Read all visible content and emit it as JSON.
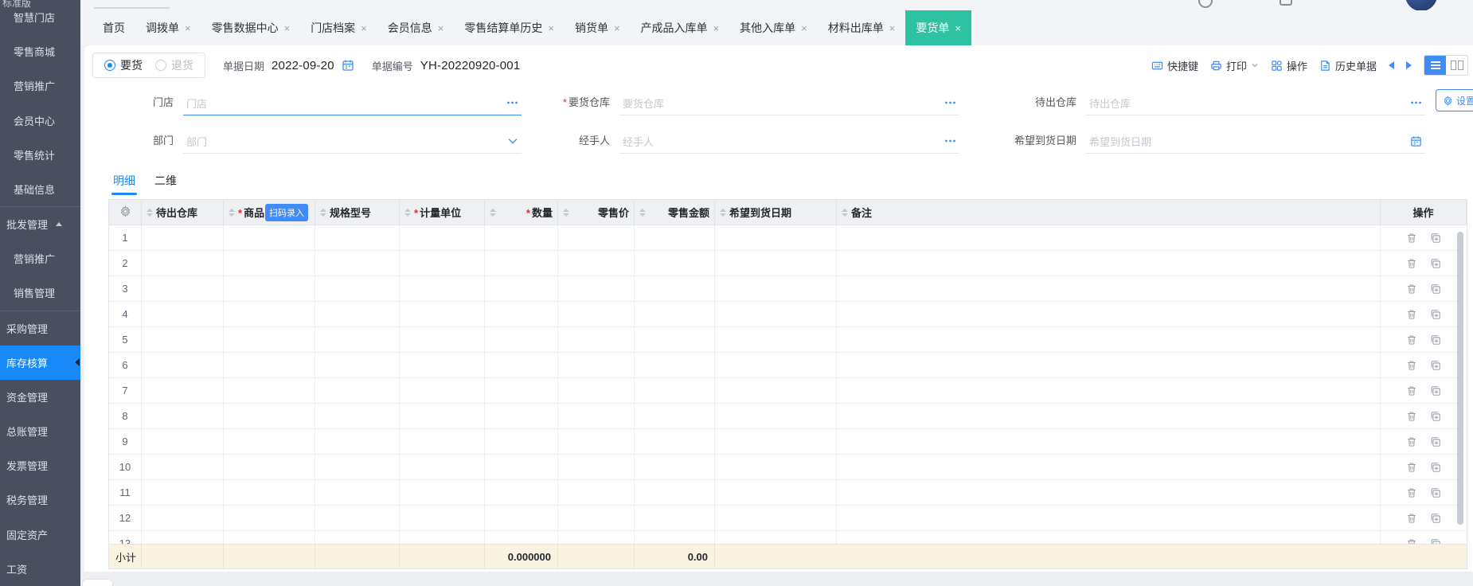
{
  "brand": {
    "edition": "标准版"
  },
  "colors": {
    "accent": "#1989fa",
    "active_tab_green": "#2cc2a2",
    "sidebar_bg": "#4a4f60",
    "sidebar_selected": "#1989fa",
    "subtotal_bg": "#fbf3e2",
    "required_red": "#f5222d"
  },
  "sidebar": {
    "items": [
      {
        "label": "智慧门店",
        "level": 2
      },
      {
        "label": "零售商城",
        "level": 2
      },
      {
        "label": "营销推广",
        "level": 2
      },
      {
        "label": "会员中心",
        "level": 2
      },
      {
        "label": "零售统计",
        "level": 2
      },
      {
        "label": "基础信息",
        "level": 2,
        "group_end": true
      },
      {
        "label": "批发管理",
        "level": 1,
        "expanded": true
      },
      {
        "label": "营销推广",
        "level": 2
      },
      {
        "label": "销售管理",
        "level": 2,
        "group_end": true
      },
      {
        "label": "采购管理",
        "level": 1
      },
      {
        "label": "库存核算",
        "level": 1,
        "selected": true
      },
      {
        "label": "资金管理",
        "level": 1
      },
      {
        "label": "总账管理",
        "level": 1
      },
      {
        "label": "发票管理",
        "level": 1
      },
      {
        "label": "税务管理",
        "level": 1
      },
      {
        "label": "固定资产",
        "level": 1
      },
      {
        "label": "工资",
        "level": 1
      }
    ]
  },
  "tabs": [
    {
      "label": "首页",
      "closable": false,
      "active": false
    },
    {
      "label": "调拨单",
      "closable": true,
      "active": false
    },
    {
      "label": "零售数据中心",
      "closable": true,
      "active": false
    },
    {
      "label": "门店档案",
      "closable": true,
      "active": false
    },
    {
      "label": "会员信息",
      "closable": true,
      "active": false
    },
    {
      "label": "零售结算单历史",
      "closable": true,
      "active": false
    },
    {
      "label": "销货单",
      "closable": true,
      "active": false
    },
    {
      "label": "产成品入库单",
      "closable": true,
      "active": false
    },
    {
      "label": "其他入库单",
      "closable": true,
      "active": false
    },
    {
      "label": "材料出库单",
      "closable": true,
      "active": false
    },
    {
      "label": "要货单",
      "closable": true,
      "active": true
    }
  ],
  "toolbar": {
    "radio_options": [
      {
        "label": "要货",
        "checked": true
      },
      {
        "label": "退货",
        "checked": false
      }
    ],
    "date_label": "单据日期",
    "date_value": "2022-09-20",
    "number_label": "单据编号",
    "number_value": "YH-20220920-001",
    "actions": [
      {
        "id": "shortcut",
        "label": "快捷键"
      },
      {
        "id": "print",
        "label": "打印",
        "dropdown": true
      },
      {
        "id": "operate",
        "label": "操作"
      },
      {
        "id": "history",
        "label": "历史单据"
      }
    ]
  },
  "form": {
    "settings_label": "设置",
    "fields": [
      {
        "label": "门店",
        "placeholder": "门店",
        "required": false,
        "suffix": "ellipsis",
        "focused": true
      },
      {
        "label": "要货仓库",
        "placeholder": "要货仓库",
        "required": true,
        "suffix": "ellipsis"
      },
      {
        "label": "待出仓库",
        "placeholder": "待出仓库",
        "required": false,
        "suffix": "ellipsis"
      },
      {
        "label": "部门",
        "placeholder": "部门",
        "required": false,
        "suffix": "chevron"
      },
      {
        "label": "经手人",
        "placeholder": "经手人",
        "required": false,
        "suffix": "ellipsis"
      },
      {
        "label": "希望到货日期",
        "placeholder": "希望到货日期",
        "required": false,
        "suffix": "calendar"
      }
    ]
  },
  "detail_tabs": [
    {
      "label": "明细",
      "active": true
    },
    {
      "label": "二维",
      "active": false
    }
  ],
  "table": {
    "columns": [
      {
        "label": "",
        "type": "gear"
      },
      {
        "label": "待出仓库",
        "sortable": true
      },
      {
        "label": "商品",
        "sortable": true,
        "required": true,
        "badge": "扫码录入"
      },
      {
        "label": "规格型号",
        "sortable": true
      },
      {
        "label": "计量单位",
        "sortable": true,
        "required": true
      },
      {
        "label": "数量",
        "sortable": true,
        "required": true,
        "align": "right"
      },
      {
        "label": "零售价",
        "sortable": true,
        "align": "right"
      },
      {
        "label": "零售金额",
        "sortable": true,
        "align": "right"
      },
      {
        "label": "希望到货日期",
        "sortable": true
      },
      {
        "label": "备注",
        "sortable": true
      },
      {
        "label": "操作",
        "type": "op"
      }
    ],
    "row_count": 13,
    "subtotal": {
      "label": "小计",
      "quantity": "0.000000",
      "amount": "0.00"
    }
  }
}
